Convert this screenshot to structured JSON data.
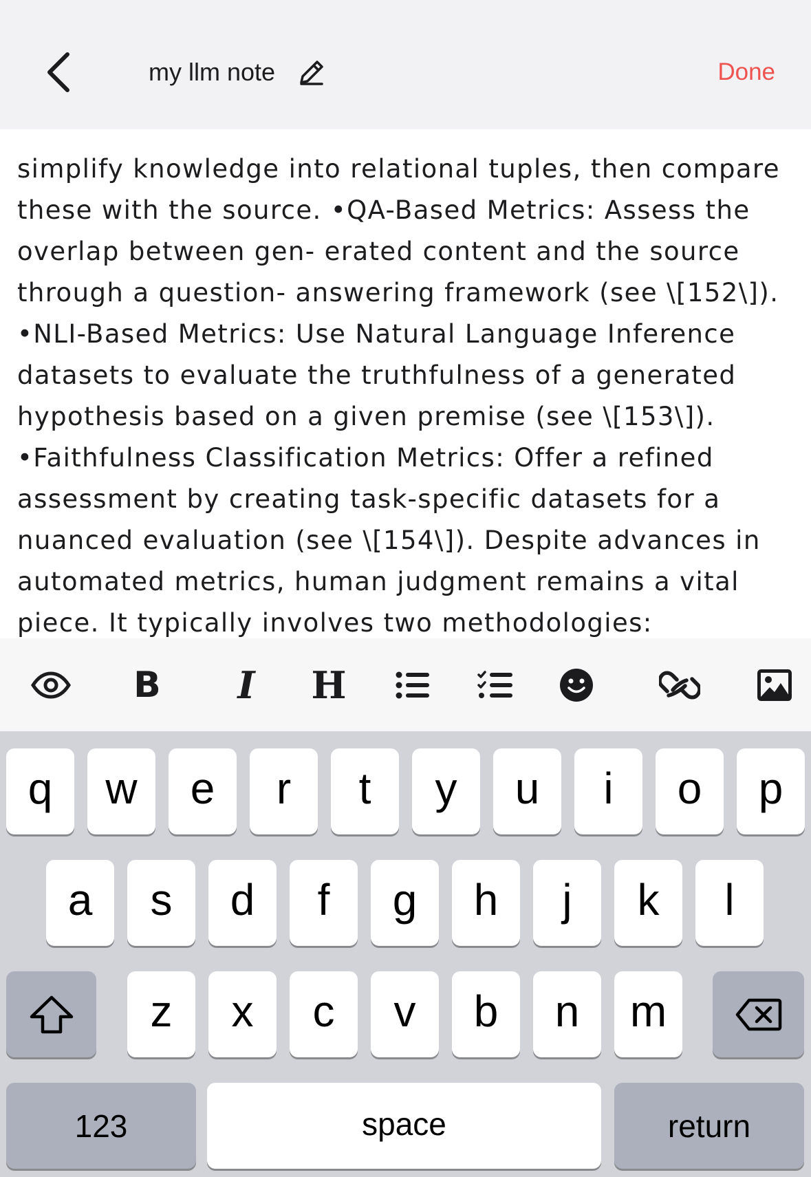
{
  "header": {
    "title": "my llm note",
    "done_label": "Done",
    "accent_color": "#ef5350"
  },
  "note": {
    "text": "simplify knowledge into relational tuples, then compare\nthese with the source. •QA-Based Metrics: Assess the\noverlap between gen- erated content and the source\nthrough a question- answering framework (see \\[152\\]).\n•NLI-Based Metrics: Use Natural Language Inference\ndatasets to evaluate the truthfulness of a generated\nhypothesis based on a given premise (see \\[153\\]).\n•Faithfulness Classification Metrics: Offer a refined\nassessment by creating task-specific datasets for a\nnuanced evaluation (see \\[154\\]). Despite advances in\nautomated metrics, human judgment remains a vital\npiece. It typically involves two methodologies:"
  },
  "toolbar": {
    "tools": [
      {
        "name": "preview",
        "icon": "eye-icon"
      },
      {
        "name": "bold",
        "icon": "bold-icon",
        "glyph": "B"
      },
      {
        "name": "italic",
        "icon": "italic-icon",
        "glyph": "I"
      },
      {
        "name": "heading",
        "icon": "heading-icon",
        "glyph": "H"
      },
      {
        "name": "bullet-list",
        "icon": "bullet-list-icon"
      },
      {
        "name": "checklist",
        "icon": "checklist-icon"
      },
      {
        "name": "emoji",
        "icon": "emoji-icon"
      },
      {
        "name": "link",
        "icon": "link-icon"
      },
      {
        "name": "image",
        "icon": "image-icon"
      }
    ]
  },
  "keyboard": {
    "row1": [
      "q",
      "w",
      "e",
      "r",
      "t",
      "y",
      "u",
      "i",
      "o",
      "p"
    ],
    "row2": [
      "a",
      "s",
      "d",
      "f",
      "g",
      "h",
      "j",
      "k",
      "l"
    ],
    "row3": [
      "z",
      "x",
      "c",
      "v",
      "b",
      "n",
      "m"
    ],
    "numbers_label": "123",
    "space_label": "space",
    "return_label": "return",
    "shift_icon": "shift-icon",
    "delete_icon": "delete-icon"
  }
}
